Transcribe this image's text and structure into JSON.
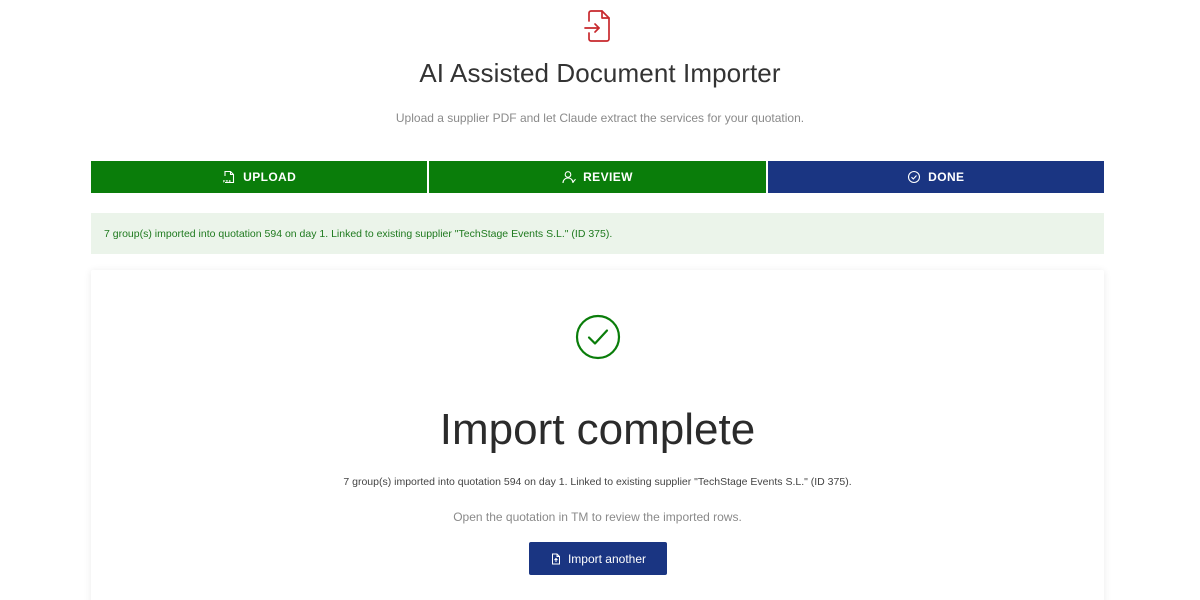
{
  "header": {
    "icon": "file-import-icon",
    "title": "AI Assisted Document Importer",
    "subtitle": "Upload a supplier PDF and let Claude extract the services for your quotation."
  },
  "stepper": {
    "steps": [
      {
        "label": "UPLOAD",
        "icon": "file-pdf-icon",
        "state": "complete"
      },
      {
        "label": "REVIEW",
        "icon": "user-icon",
        "state": "complete"
      },
      {
        "label": "DONE",
        "icon": "check-circle-icon",
        "state": "active"
      }
    ]
  },
  "alert": {
    "message": "7 group(s) imported into quotation 594 on day 1. Linked to existing supplier \"TechStage Events S.L.\" (ID 375)."
  },
  "result": {
    "icon": "check-circle-icon",
    "title": "Import complete",
    "message": "7 group(s) imported into quotation 594 on day 1. Linked to existing supplier \"TechStage Events S.L.\" (ID 375).",
    "hint": "Open the quotation in TM to review the imported rows.",
    "button_label": "Import another"
  },
  "colors": {
    "brand_red": "#c8282d",
    "success_green": "#0a7d0a",
    "primary_blue": "#1a3582",
    "alert_bg": "#ebf4ea"
  }
}
